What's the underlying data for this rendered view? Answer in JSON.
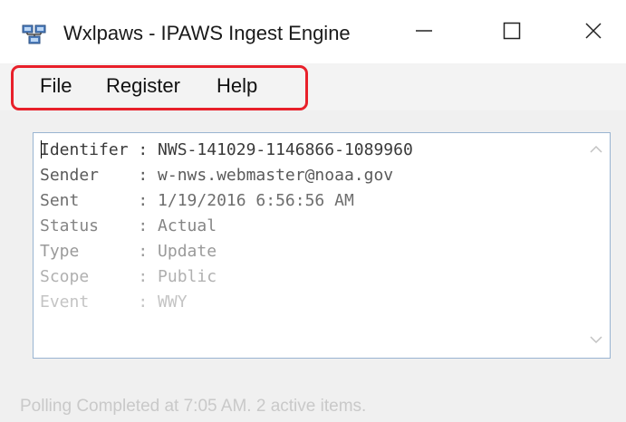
{
  "window": {
    "title": "Wxlpaws - IPAWS Ingest Engine",
    "icon": "network-computers-icon"
  },
  "menu": {
    "items": [
      {
        "label": "File"
      },
      {
        "label": "Register"
      },
      {
        "label": "Help"
      }
    ],
    "highlight_color": "#e8202a"
  },
  "details": {
    "rows": [
      {
        "text": "Identifer : NWS-141029-1146866-1089960",
        "color": "#3a3a3a"
      },
      {
        "text": "Sender    : w-nws.webmaster@noaa.gov",
        "color": "#5a5a5a"
      },
      {
        "text": "Sent      : 1/19/2016 6:56:56 AM",
        "color": "#6e6e6e"
      },
      {
        "text": "Status    : Actual",
        "color": "#858585"
      },
      {
        "text": "Type      : Update",
        "color": "#9a9a9a"
      },
      {
        "text": "Scope     : Public",
        "color": "#b0b0b0"
      },
      {
        "text": "Event     : WWY",
        "color": "#c4c4c4"
      }
    ]
  },
  "status": {
    "text": "Polling Completed at 7:05 AM. 2 active items."
  }
}
